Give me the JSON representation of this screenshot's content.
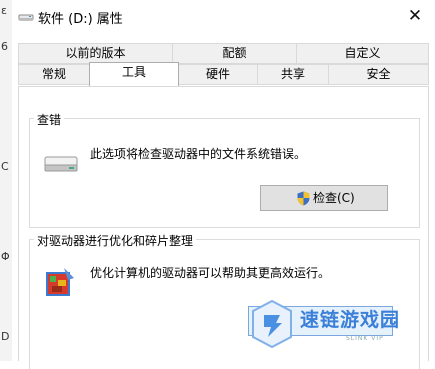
{
  "window": {
    "title": "软件 (D:) 属性",
    "close_label": "✕"
  },
  "left_strip": {
    "chars": [
      "ε",
      "6",
      "C",
      "Φ",
      "D"
    ]
  },
  "tabs_row_top": [
    "以前的版本",
    "配额",
    "自定义"
  ],
  "tabs_row_bottom": [
    "常规",
    "工具",
    "硬件",
    "共享",
    "安全"
  ],
  "active_tab": "工具",
  "error_check": {
    "title": "查错",
    "description": "此选项将检查驱动器中的文件系统错误。",
    "button_label": "检查(C)",
    "icon": "drive-icon",
    "button_icon": "uac-shield-icon"
  },
  "optimize": {
    "title": "对驱动器进行优化和碎片整理",
    "description": "优化计算机的驱动器可以帮助其更高效运行。",
    "icon": "defrag-icon"
  },
  "watermark": {
    "text": "速链游戏园",
    "sub": "SLINK VIP"
  },
  "colors": {
    "accent": "#3b7fd8",
    "tab_bg": "#f0f0f0",
    "button_bg": "#e1e1e1"
  }
}
